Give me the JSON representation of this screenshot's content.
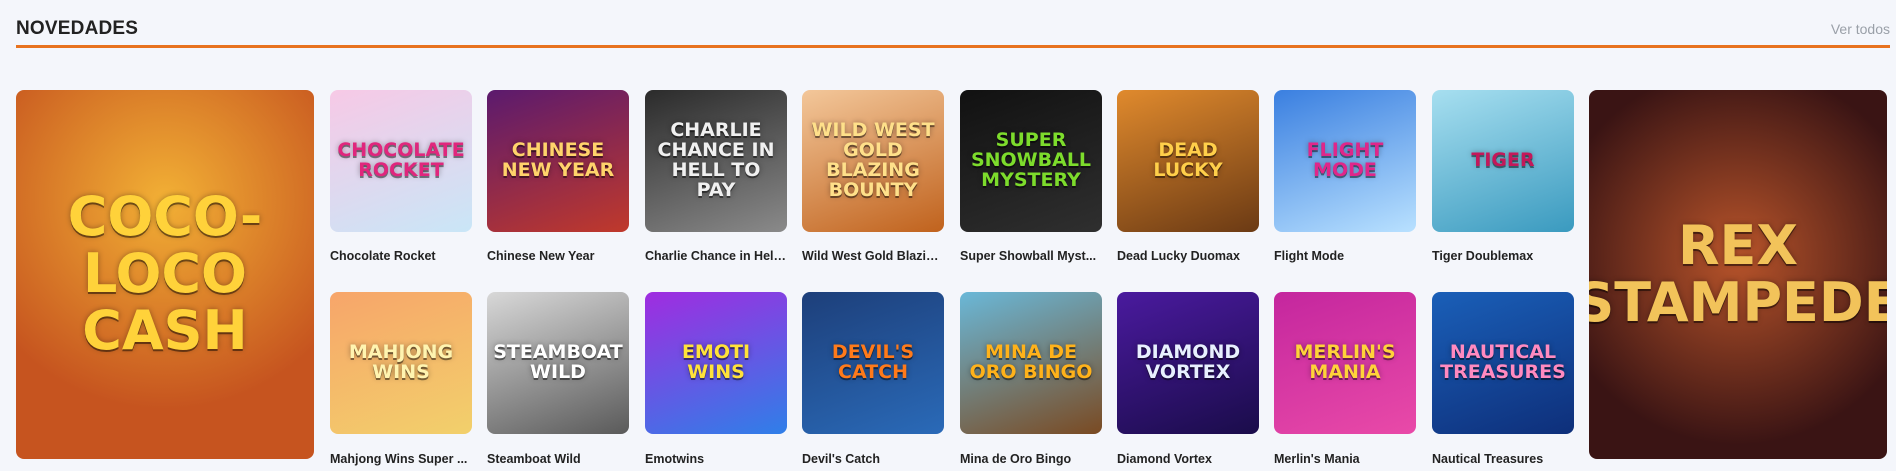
{
  "section": {
    "title": "NOVEDADES",
    "view_all": "Ver todos",
    "accent": "#e8731f"
  },
  "featured_left": {
    "name": "Coco-Loco Cash",
    "logo_text": "COCO-LOCO CASH",
    "colors": [
      "#c6541f",
      "#f2b035"
    ]
  },
  "featured_right": {
    "name": "Rex Stampede",
    "logo_text": "REX STAMPEDE",
    "colors": [
      "#3a1414",
      "#b8542a"
    ]
  },
  "games_row1": [
    {
      "label": "Chocolate Rocket",
      "logo": "CHOCOLATE ROCKET",
      "colors": [
        "#f7c9e6",
        "#c9e6f7"
      ],
      "ink": "#e0267d"
    },
    {
      "label": "Chinese New Year",
      "logo": "CHINESE NEW YEAR",
      "colors": [
        "#5b1a6e",
        "#c0392b"
      ],
      "ink": "#ffd36b"
    },
    {
      "label": "Charlie Chance in Hell...",
      "logo": "CHARLIE CHANCE IN HELL TO PAY",
      "colors": [
        "#2b2b2b",
        "#8a8a8a"
      ],
      "ink": "#f0f0f0"
    },
    {
      "label": "Wild West Gold Blazin...",
      "logo": "WILD WEST GOLD BLAZING BOUNTY",
      "colors": [
        "#f3c79a",
        "#c0621d"
      ],
      "ink": "#ffe08a"
    },
    {
      "label": "Super Showball Myst...",
      "logo": "SUPER SNOWBALL MYSTERY",
      "colors": [
        "#111111",
        "#2f2f2f"
      ],
      "ink": "#7ddc2c"
    },
    {
      "label": "Dead Lucky Duomax",
      "logo": "DEAD LUCKY",
      "colors": [
        "#e08a2d",
        "#6b3a14"
      ],
      "ink": "#ffcf4a"
    },
    {
      "label": "Flight Mode",
      "logo": "FLIGHT MODE",
      "colors": [
        "#3a7fe0",
        "#b9e1ff"
      ],
      "ink": "#e0268a"
    },
    {
      "label": "Tiger Doublemax",
      "logo": "TIGER",
      "colors": [
        "#a7dff0",
        "#3a9abf"
      ],
      "ink": "#c4185a"
    }
  ],
  "games_row2": [
    {
      "label": "Mahjong Wins Super ...",
      "logo": "MAHJONG WINS",
      "colors": [
        "#f7a56a",
        "#f2d06b"
      ],
      "ink": "#fff4b0"
    },
    {
      "label": "Steamboat Wild",
      "logo": "STEAMBOAT WILD",
      "colors": [
        "#d8d8d8",
        "#5a5a5a"
      ],
      "ink": "#ffffff"
    },
    {
      "label": "Emotwins",
      "logo": "EMOTI WINS",
      "colors": [
        "#a02ce0",
        "#2f7fe8"
      ],
      "ink": "#ffe23a"
    },
    {
      "label": "Devil's Catch",
      "logo": "DEVIL'S CATCH",
      "colors": [
        "#1d3f7a",
        "#2a6ab8"
      ],
      "ink": "#ff7a1a"
    },
    {
      "label": "Mina de Oro Bingo",
      "logo": "MINA DE ORO BINGO",
      "colors": [
        "#6ab8d8",
        "#7a4a22"
      ],
      "ink": "#ffb21a"
    },
    {
      "label": "Diamond Vortex",
      "logo": "DIAMOND VORTEX",
      "colors": [
        "#4a1a9e",
        "#1a0c4a"
      ],
      "ink": "#e8f0ff"
    },
    {
      "label": "Merlin's Mania",
      "logo": "MERLIN'S MANIA",
      "colors": [
        "#c4269e",
        "#e94aa8"
      ],
      "ink": "#ffd23a"
    },
    {
      "label": "Nautical Treasures",
      "logo": "NAUTICAL TREASURES",
      "colors": [
        "#1a5fb8",
        "#0e2f7a"
      ],
      "ink": "#ff8ac0"
    }
  ]
}
